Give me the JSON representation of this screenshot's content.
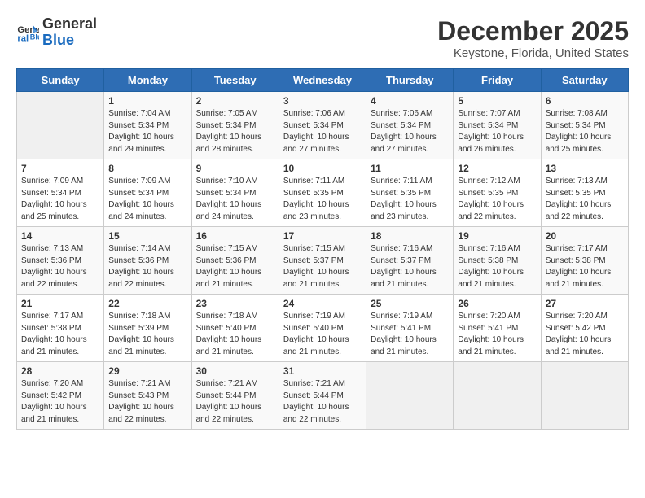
{
  "logo": {
    "line1": "General",
    "line2": "Blue"
  },
  "title": "December 2025",
  "subtitle": "Keystone, Florida, United States",
  "days_of_week": [
    "Sunday",
    "Monday",
    "Tuesday",
    "Wednesday",
    "Thursday",
    "Friday",
    "Saturday"
  ],
  "weeks": [
    [
      {
        "num": "",
        "info": ""
      },
      {
        "num": "1",
        "info": "Sunrise: 7:04 AM\nSunset: 5:34 PM\nDaylight: 10 hours\nand 29 minutes."
      },
      {
        "num": "2",
        "info": "Sunrise: 7:05 AM\nSunset: 5:34 PM\nDaylight: 10 hours\nand 28 minutes."
      },
      {
        "num": "3",
        "info": "Sunrise: 7:06 AM\nSunset: 5:34 PM\nDaylight: 10 hours\nand 27 minutes."
      },
      {
        "num": "4",
        "info": "Sunrise: 7:06 AM\nSunset: 5:34 PM\nDaylight: 10 hours\nand 27 minutes."
      },
      {
        "num": "5",
        "info": "Sunrise: 7:07 AM\nSunset: 5:34 PM\nDaylight: 10 hours\nand 26 minutes."
      },
      {
        "num": "6",
        "info": "Sunrise: 7:08 AM\nSunset: 5:34 PM\nDaylight: 10 hours\nand 25 minutes."
      }
    ],
    [
      {
        "num": "7",
        "info": "Sunrise: 7:09 AM\nSunset: 5:34 PM\nDaylight: 10 hours\nand 25 minutes."
      },
      {
        "num": "8",
        "info": "Sunrise: 7:09 AM\nSunset: 5:34 PM\nDaylight: 10 hours\nand 24 minutes."
      },
      {
        "num": "9",
        "info": "Sunrise: 7:10 AM\nSunset: 5:34 PM\nDaylight: 10 hours\nand 24 minutes."
      },
      {
        "num": "10",
        "info": "Sunrise: 7:11 AM\nSunset: 5:35 PM\nDaylight: 10 hours\nand 23 minutes."
      },
      {
        "num": "11",
        "info": "Sunrise: 7:11 AM\nSunset: 5:35 PM\nDaylight: 10 hours\nand 23 minutes."
      },
      {
        "num": "12",
        "info": "Sunrise: 7:12 AM\nSunset: 5:35 PM\nDaylight: 10 hours\nand 22 minutes."
      },
      {
        "num": "13",
        "info": "Sunrise: 7:13 AM\nSunset: 5:35 PM\nDaylight: 10 hours\nand 22 minutes."
      }
    ],
    [
      {
        "num": "14",
        "info": "Sunrise: 7:13 AM\nSunset: 5:36 PM\nDaylight: 10 hours\nand 22 minutes."
      },
      {
        "num": "15",
        "info": "Sunrise: 7:14 AM\nSunset: 5:36 PM\nDaylight: 10 hours\nand 22 minutes."
      },
      {
        "num": "16",
        "info": "Sunrise: 7:15 AM\nSunset: 5:36 PM\nDaylight: 10 hours\nand 21 minutes."
      },
      {
        "num": "17",
        "info": "Sunrise: 7:15 AM\nSunset: 5:37 PM\nDaylight: 10 hours\nand 21 minutes."
      },
      {
        "num": "18",
        "info": "Sunrise: 7:16 AM\nSunset: 5:37 PM\nDaylight: 10 hours\nand 21 minutes."
      },
      {
        "num": "19",
        "info": "Sunrise: 7:16 AM\nSunset: 5:38 PM\nDaylight: 10 hours\nand 21 minutes."
      },
      {
        "num": "20",
        "info": "Sunrise: 7:17 AM\nSunset: 5:38 PM\nDaylight: 10 hours\nand 21 minutes."
      }
    ],
    [
      {
        "num": "21",
        "info": "Sunrise: 7:17 AM\nSunset: 5:38 PM\nDaylight: 10 hours\nand 21 minutes."
      },
      {
        "num": "22",
        "info": "Sunrise: 7:18 AM\nSunset: 5:39 PM\nDaylight: 10 hours\nand 21 minutes."
      },
      {
        "num": "23",
        "info": "Sunrise: 7:18 AM\nSunset: 5:40 PM\nDaylight: 10 hours\nand 21 minutes."
      },
      {
        "num": "24",
        "info": "Sunrise: 7:19 AM\nSunset: 5:40 PM\nDaylight: 10 hours\nand 21 minutes."
      },
      {
        "num": "25",
        "info": "Sunrise: 7:19 AM\nSunset: 5:41 PM\nDaylight: 10 hours\nand 21 minutes."
      },
      {
        "num": "26",
        "info": "Sunrise: 7:20 AM\nSunset: 5:41 PM\nDaylight: 10 hours\nand 21 minutes."
      },
      {
        "num": "27",
        "info": "Sunrise: 7:20 AM\nSunset: 5:42 PM\nDaylight: 10 hours\nand 21 minutes."
      }
    ],
    [
      {
        "num": "28",
        "info": "Sunrise: 7:20 AM\nSunset: 5:42 PM\nDaylight: 10 hours\nand 21 minutes."
      },
      {
        "num": "29",
        "info": "Sunrise: 7:21 AM\nSunset: 5:43 PM\nDaylight: 10 hours\nand 22 minutes."
      },
      {
        "num": "30",
        "info": "Sunrise: 7:21 AM\nSunset: 5:44 PM\nDaylight: 10 hours\nand 22 minutes."
      },
      {
        "num": "31",
        "info": "Sunrise: 7:21 AM\nSunset: 5:44 PM\nDaylight: 10 hours\nand 22 minutes."
      },
      {
        "num": "",
        "info": ""
      },
      {
        "num": "",
        "info": ""
      },
      {
        "num": "",
        "info": ""
      }
    ]
  ]
}
